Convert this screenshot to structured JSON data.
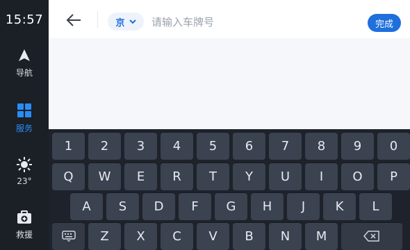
{
  "status": {
    "time": "15:57"
  },
  "dock": {
    "items": [
      {
        "label": "导航"
      },
      {
        "label": "服务"
      },
      {
        "label": "23°"
      },
      {
        "label": "救援"
      }
    ],
    "active_color": "#2a8cf6"
  },
  "topbar": {
    "province_label": "京",
    "plate_placeholder": "请输入车牌号",
    "done_label": "完成"
  },
  "keyboard": {
    "rows": [
      [
        "1",
        "2",
        "3",
        "4",
        "5",
        "6",
        "7",
        "8",
        "9",
        "0"
      ],
      [
        "Q",
        "W",
        "E",
        "R",
        "T",
        "Y",
        "U",
        "I",
        "O",
        "P"
      ],
      [
        "A",
        "S",
        "D",
        "F",
        "G",
        "H",
        "J",
        "K",
        "L"
      ],
      [
        "Z",
        "X",
        "C",
        "V",
        "B",
        "N",
        "M"
      ]
    ]
  },
  "colors": {
    "accent": "#1f6fdc",
    "key_bg": "#3b4250",
    "keyboard_bg": "#1e232b"
  }
}
